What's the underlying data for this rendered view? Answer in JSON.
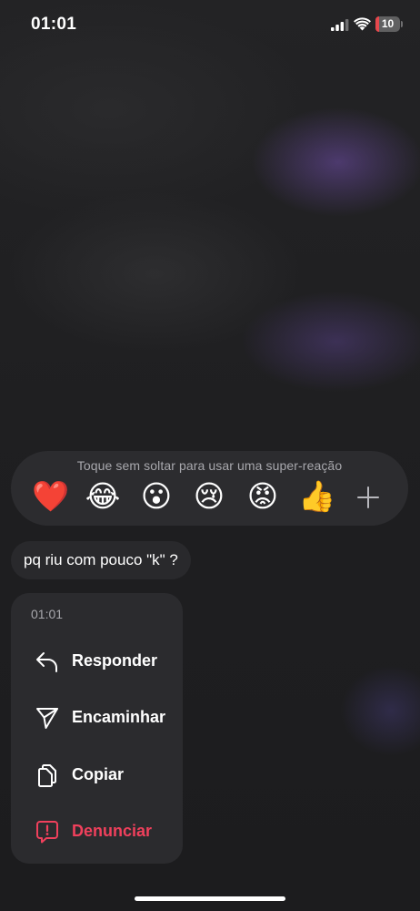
{
  "status_bar": {
    "time": "01:01",
    "battery_level": "10",
    "battery_fraction": 0.1,
    "battery_color": "#e5484d"
  },
  "reactions": {
    "hint": "Toque sem soltar para usar uma super-reação",
    "emojis": [
      "❤️",
      "😂",
      "😮",
      "😢",
      "😡",
      "👍"
    ],
    "add_icon": "plus-icon"
  },
  "message": {
    "text": "pq riu com pouco \"k\" ?"
  },
  "context_menu": {
    "time": "01:01",
    "items": [
      {
        "label": "Responder",
        "icon": "reply-icon"
      },
      {
        "label": "Encaminhar",
        "icon": "send-icon"
      },
      {
        "label": "Copiar",
        "icon": "copy-icon"
      },
      {
        "label": "Denunciar",
        "icon": "report-icon",
        "color": "#f0405c"
      }
    ]
  }
}
